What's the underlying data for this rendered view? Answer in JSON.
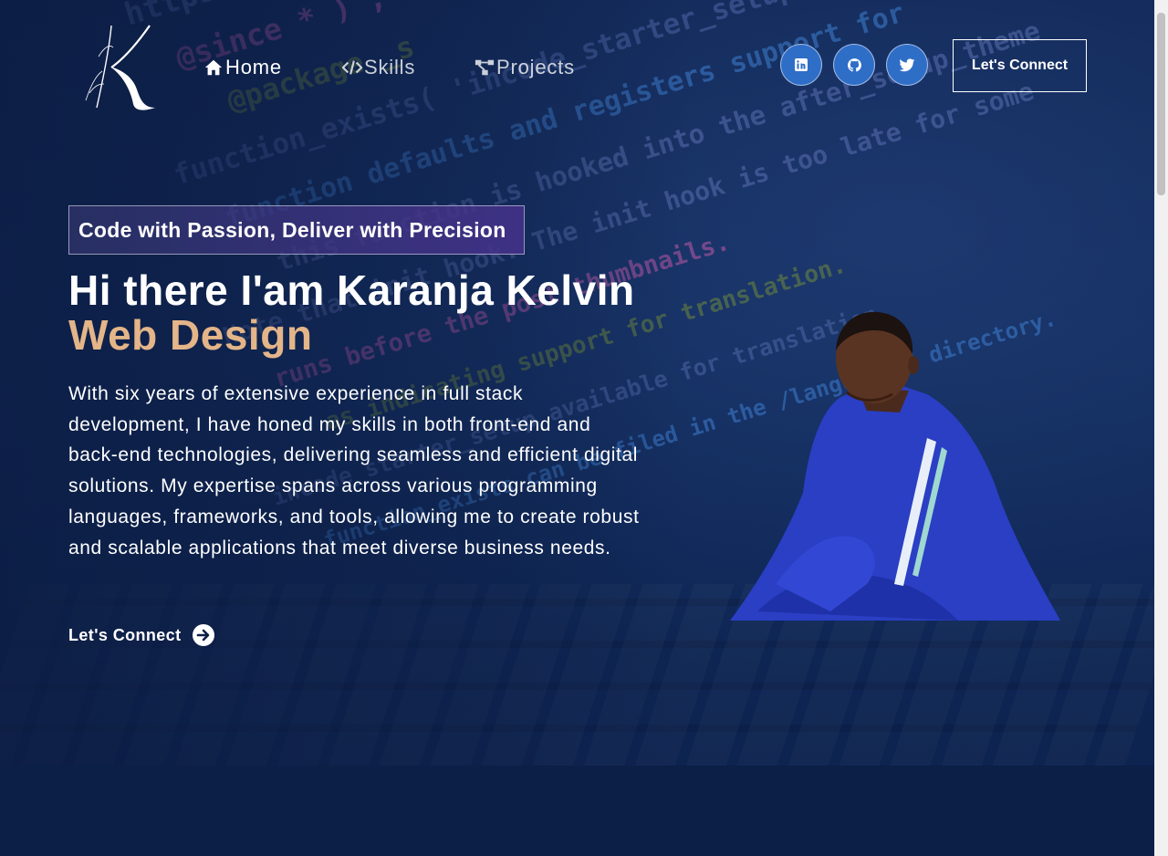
{
  "nav": {
    "logo_name": "Karanja Kelvin",
    "links": [
      {
        "label": "Home",
        "icon": "home-icon"
      },
      {
        "label": "Skills",
        "icon": "code-icon"
      },
      {
        "label": "Projects",
        "icon": "project-diagram-icon"
      }
    ],
    "social": [
      {
        "name": "LinkedIn",
        "icon": "linkedin-icon"
      },
      {
        "name": "GitHub",
        "icon": "github-icon"
      },
      {
        "name": "Twitter",
        "icon": "twitter-icon"
      }
    ],
    "connect_label": "Let's Connect"
  },
  "hero": {
    "tagline": "Code with Passion, Deliver with Precision",
    "headline": "Hi there I'am Karanja Kelvin",
    "role": "Web Design",
    "bio": "With six years of extensive experience in full stack development, I have honed my skills in both front-end and back-end technologies, delivering seamless and efficient digital solutions. My expertise spans across various programming languages, frameworks, and tools, allowing me to create robust and scalable applications that meet diverse business needs.",
    "cta_label": "Let's Connect"
  },
  "background_code": [
    "https://developer.wordpress.org",
    "@since  * ) ;",
    "@package  _s",
    "function_exists( 'incode_starter_setup' )",
    "function  defaults and registers support for",
    "this function is hooked into the after_setup_theme",
    "Note  that  init hook. The init hook is too late for some",
    "runs before the  post thumbnails.",
    "as indicating support for translation.",
    "incode_starter_setup  available for translation.",
    "function_exists  can be filed in the /languages/ directory."
  ],
  "colors": {
    "background": "#0b1f47",
    "accent": "#e3b588",
    "social_button": "#2f6ec7",
    "tagline_gradient_end": "#46328c"
  }
}
